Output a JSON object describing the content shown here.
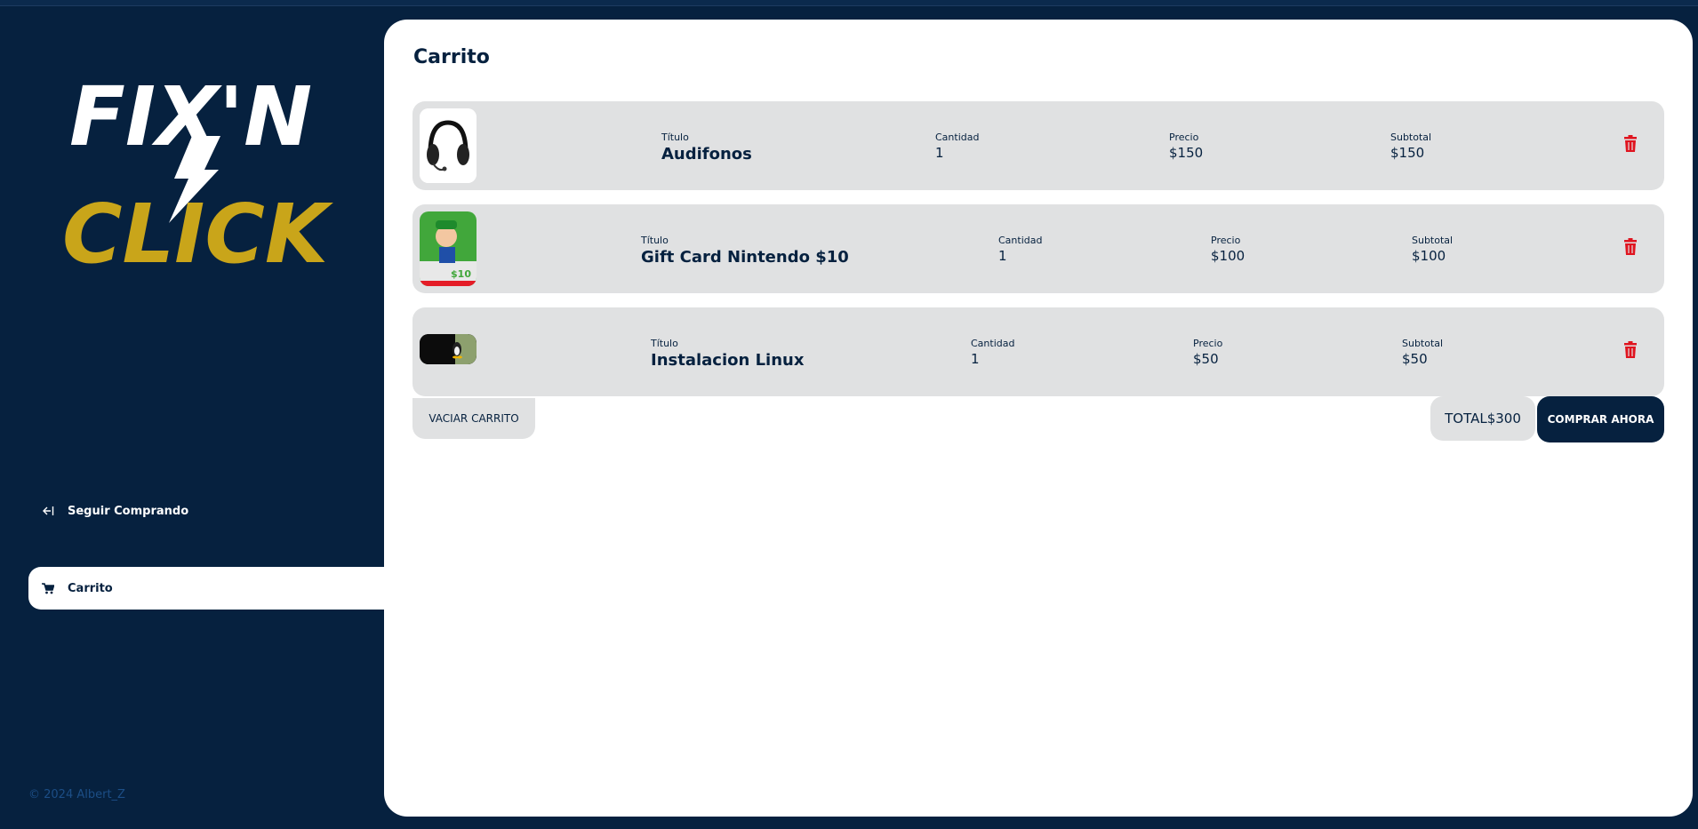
{
  "brand": {
    "logo_line1": "FIX'N",
    "logo_line2": "CLICK",
    "accent": "#c9a51a",
    "navy": "#06213f"
  },
  "sidebar": {
    "items": [
      {
        "label": "Seguir Comprando",
        "icon": "exit-arrow-icon"
      },
      {
        "label": "Carrito",
        "icon": "cart-icon"
      }
    ],
    "footer": "© 2024 Albert_Z"
  },
  "cart": {
    "title": "Carrito",
    "labels": {
      "title": "Título",
      "qty": "Cantidad",
      "price": "Precio",
      "subtotal": "Subtotal"
    },
    "items": [
      {
        "title": "Audifonos",
        "qty": "1",
        "price": "$150",
        "subtotal": "$150",
        "image": "headphones"
      },
      {
        "title": "Gift Card Nintendo $10",
        "qty": "1",
        "price": "$100",
        "subtotal": "$100",
        "image": "nintendo-gift-card"
      },
      {
        "title": "Instalacion Linux",
        "qty": "1",
        "price": "$50",
        "subtotal": "$50",
        "image": "linux-install"
      }
    ],
    "empty_label": "VACIAR CARRITO",
    "total_label": "TOTAL",
    "total_value": "$300",
    "buy_label": "COMPRAR AHORA",
    "delete_color": "#e0141f"
  },
  "card_amount": "$10"
}
